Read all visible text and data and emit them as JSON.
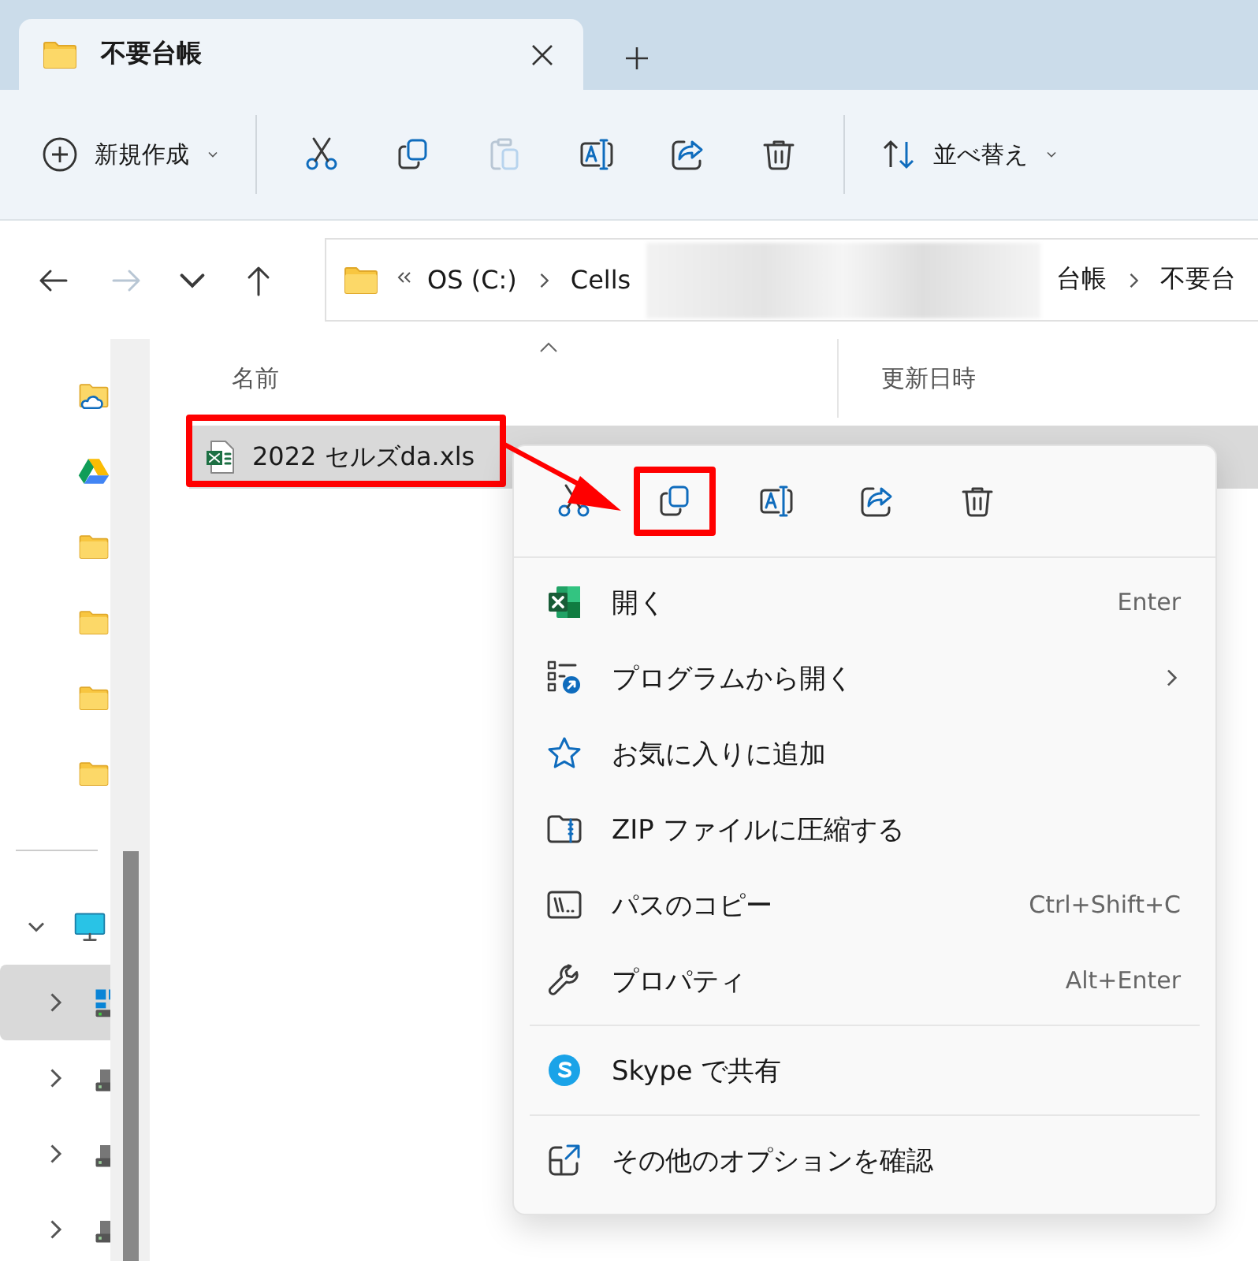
{
  "tab": {
    "title": "不要台帳"
  },
  "toolbar": {
    "new_button": "新規作成",
    "actions": [
      {
        "kind": "cut",
        "disabled": false
      },
      {
        "kind": "copy",
        "disabled": false
      },
      {
        "kind": "paste",
        "disabled": true
      },
      {
        "kind": "rename",
        "disabled": false
      },
      {
        "kind": "share",
        "disabled": false
      },
      {
        "kind": "delete",
        "disabled": false
      }
    ],
    "sort_button": "並べ替え"
  },
  "navigation": [
    {
      "kind": "back",
      "disabled": false
    },
    {
      "kind": "forward",
      "disabled": true
    },
    {
      "kind": "recent",
      "disabled": false
    },
    {
      "kind": "up",
      "disabled": false
    }
  ],
  "address": {
    "crumbs": [
      {
        "kind": "crumb",
        "text": "OS (C:)"
      },
      {
        "kind": "separator"
      },
      {
        "kind": "crumb",
        "text": "Cells"
      },
      {
        "kind": "redacted"
      },
      {
        "kind": "crumb",
        "text": "台帳"
      },
      {
        "kind": "separator"
      },
      {
        "kind": "crumb",
        "text": "不要台"
      }
    ]
  },
  "sidebar": {
    "items": [
      {
        "kind": "cloud-folder"
      },
      {
        "kind": "google-drive"
      },
      {
        "kind": "folder"
      },
      {
        "kind": "folder"
      },
      {
        "kind": "folder"
      },
      {
        "kind": "folder"
      }
    ],
    "tree": [
      {
        "kind": "pc",
        "expanded": true,
        "selected": false,
        "children": [
          {
            "kind": "system-drive",
            "expanded": false,
            "selected": true
          },
          {
            "kind": "drive",
            "expanded": false,
            "selected": false
          },
          {
            "kind": "drive",
            "expanded": false,
            "selected": false
          },
          {
            "kind": "drive",
            "expanded": false,
            "selected": false
          }
        ]
      }
    ]
  },
  "columns": [
    {
      "label": "名前",
      "sorted": true
    },
    {
      "label": "更新日時",
      "sorted": false
    }
  ],
  "files": [
    {
      "name": "2022 セルズda.xls",
      "selected": true,
      "highlighted": true
    }
  ],
  "context_menu": {
    "quick_actions": [
      {
        "kind": "cut",
        "highlighted": false
      },
      {
        "kind": "copy",
        "highlighted": true
      },
      {
        "kind": "rename",
        "highlighted": false
      },
      {
        "kind": "share",
        "highlighted": false
      },
      {
        "kind": "delete",
        "highlighted": false
      }
    ],
    "groups": [
      [
        {
          "kind": "excel",
          "label": "開く",
          "shortcut": "Enter",
          "submenu": false
        },
        {
          "kind": "open-with",
          "label": "プログラムから開く",
          "submenu": true
        },
        {
          "kind": "star",
          "label": "お気に入りに追加",
          "submenu": false
        },
        {
          "kind": "zip",
          "label": "ZIP ファイルに圧縮する",
          "submenu": false
        },
        {
          "kind": "path",
          "label": "パスのコピー",
          "shortcut": "Ctrl+Shift+C",
          "submenu": false
        },
        {
          "kind": "wrench",
          "label": "プロパティ",
          "shortcut": "Alt+Enter",
          "submenu": false
        }
      ],
      [
        {
          "kind": "skype",
          "label": "Skype で共有",
          "submenu": false
        }
      ],
      [
        {
          "kind": "more",
          "label": "その他のオプションを確認",
          "submenu": false
        }
      ]
    ]
  }
}
